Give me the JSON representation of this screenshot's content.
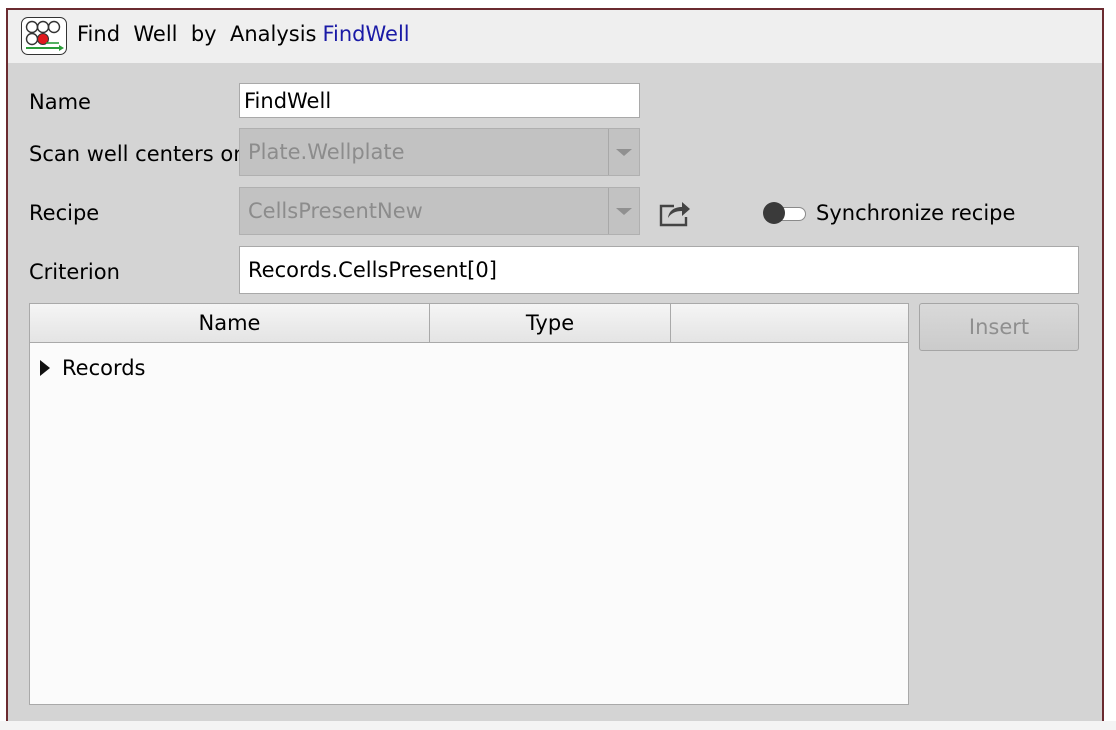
{
  "title": {
    "kind": "Find  Well  by  Analysis",
    "name": "FindWell",
    "name_color": "#1a1aa6",
    "logo_icon": "well-plate-analysis-icon"
  },
  "form": {
    "name": {
      "label": "Name",
      "value": "FindWell"
    },
    "scan": {
      "label": "Scan well centers on",
      "value": "Plate.Wellplate"
    },
    "recipe": {
      "label": "Recipe",
      "value": "CellsPresentNew",
      "open_icon": "share-export-icon",
      "sync_label": "Synchronize recipe",
      "sync_on": false
    },
    "criterion": {
      "label": "Criterion",
      "value": "Records.CellsPresent[0]"
    }
  },
  "tree": {
    "columns": [
      "Name",
      "Type",
      ""
    ],
    "rows": [
      {
        "label": "Records",
        "expanded": false
      }
    ]
  },
  "actions": {
    "insert_label": "Insert"
  },
  "colors": {
    "panel_bg": "#d4d4d4",
    "frame_border": "#6b2b30",
    "disabled_text": "#8c8c8c"
  }
}
